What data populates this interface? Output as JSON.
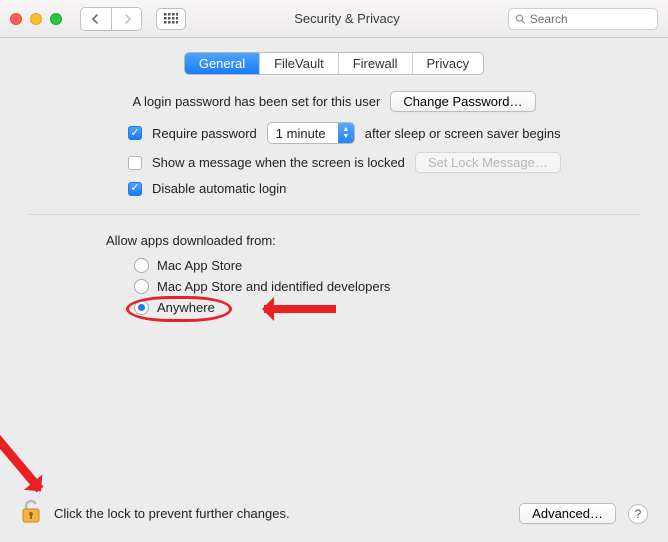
{
  "window": {
    "title": "Security & Privacy"
  },
  "search": {
    "placeholder": "Search"
  },
  "tabs": [
    {
      "label": "General",
      "active": true
    },
    {
      "label": "FileVault",
      "active": false
    },
    {
      "label": "Firewall",
      "active": false
    },
    {
      "label": "Privacy",
      "active": false
    }
  ],
  "password_section": {
    "intro": "A login password has been set for this user",
    "change_button": "Change Password…",
    "require_label": "Require password",
    "require_checked": true,
    "delay_value": "1 minute",
    "after_text": "after sleep or screen saver begins",
    "show_message_label": "Show a message when the screen is locked",
    "show_message_checked": false,
    "set_lock_button": "Set Lock Message…",
    "disable_autologin_label": "Disable automatic login",
    "disable_autologin_checked": true
  },
  "gatekeeper": {
    "title": "Allow apps downloaded from:",
    "options": [
      {
        "label": "Mac App Store",
        "selected": false
      },
      {
        "label": "Mac App Store and identified developers",
        "selected": false
      },
      {
        "label": "Anywhere",
        "selected": true
      }
    ]
  },
  "footer": {
    "lock_text": "Click the lock to prevent further changes.",
    "advanced_button": "Advanced…",
    "help_label": "?"
  },
  "annotations": {
    "anywhere_circled": true,
    "arrows": [
      "anywhere",
      "lock"
    ]
  }
}
